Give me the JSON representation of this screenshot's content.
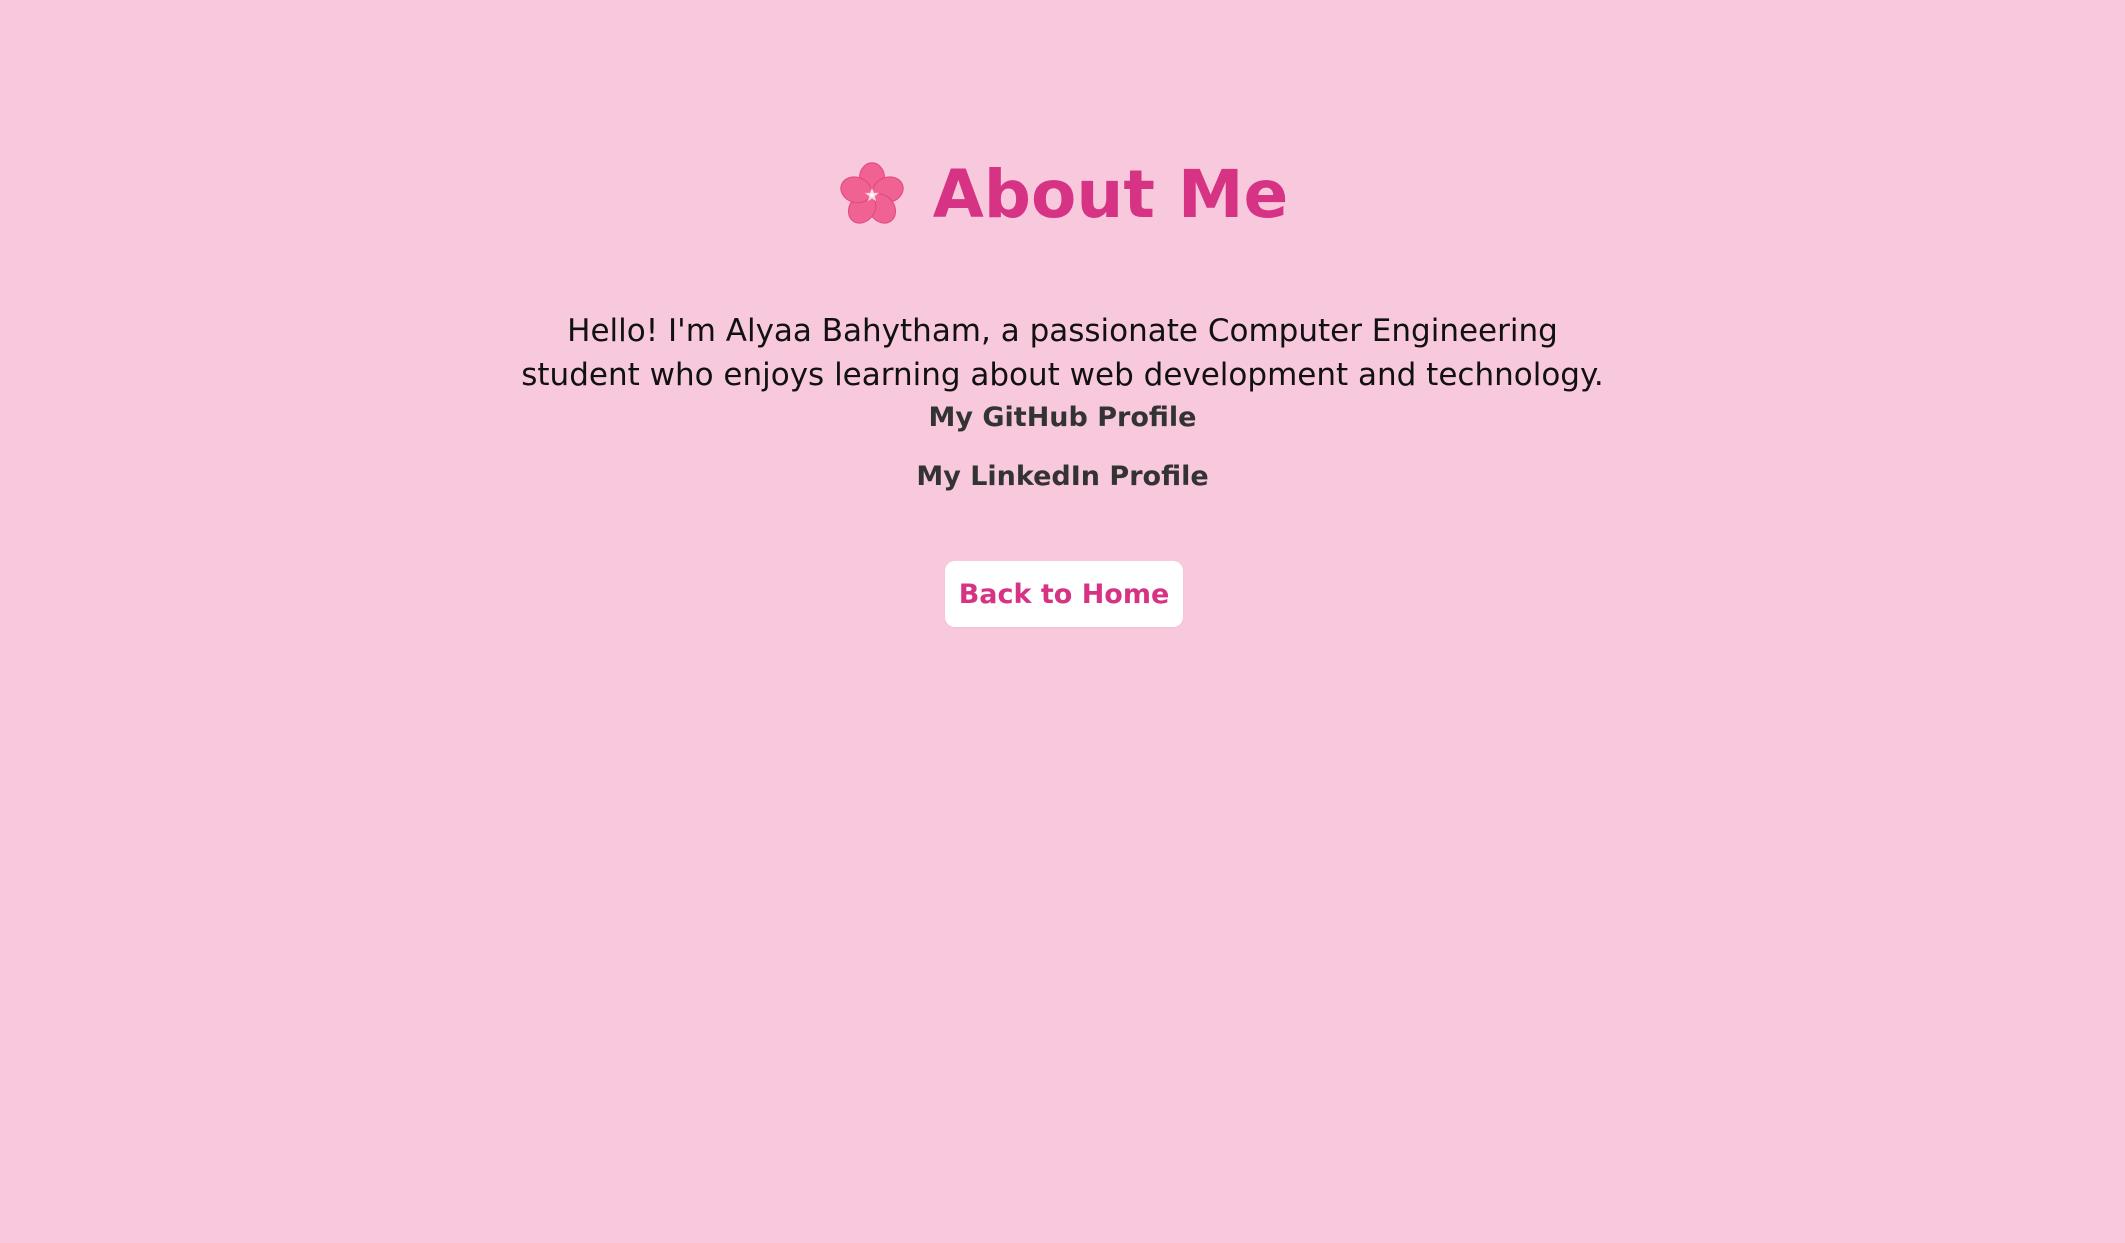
{
  "header": {
    "icon": "cherry-blossom-icon",
    "title": "About Me"
  },
  "intro": {
    "line1": "Hello! I'm Alyaa Bahytham, a passionate Computer Engineering",
    "line2": "student who enjoys learning about web development and technology."
  },
  "links": {
    "github": "My GitHub Profile",
    "linkedin": "My LinkedIn Profile"
  },
  "button": {
    "back": "Back to Home"
  },
  "colors": {
    "background": "#f8c8dc",
    "accent": "#d63384",
    "text": "#111111",
    "button_bg": "#ffffff"
  }
}
